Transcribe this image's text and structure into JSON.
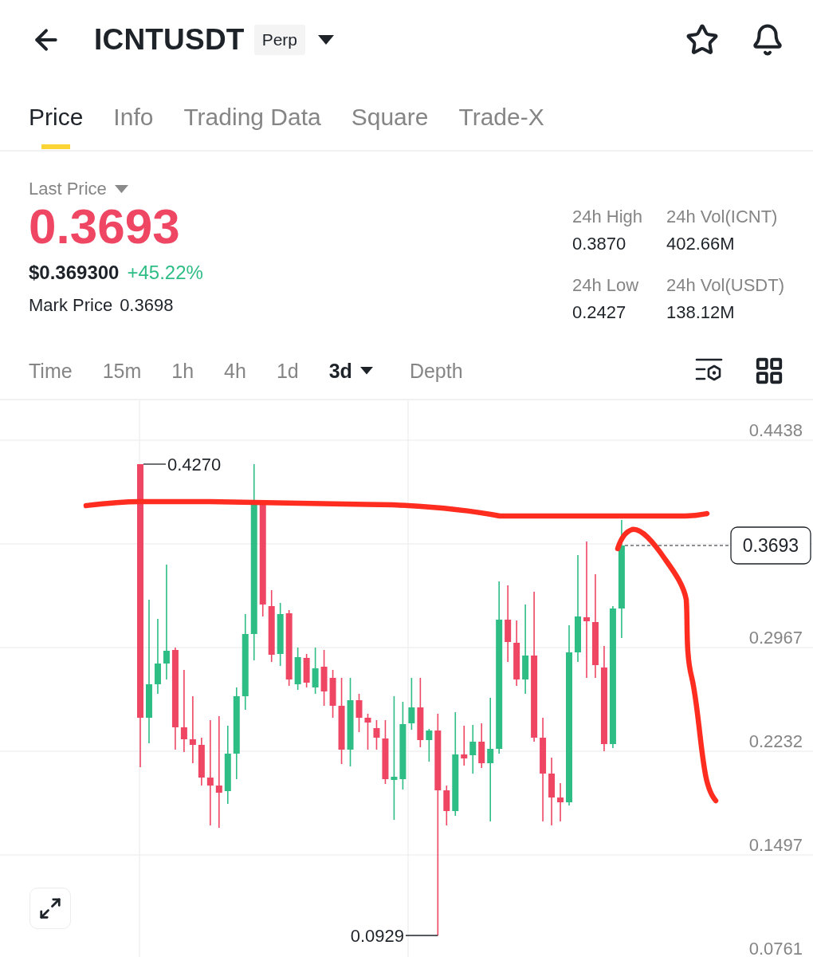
{
  "header": {
    "title": "ICNTUSDT",
    "badge": "Perp"
  },
  "tabs": [
    {
      "label": "Price",
      "selected": true
    },
    {
      "label": "Info",
      "selected": false
    },
    {
      "label": "Trading Data",
      "selected": false
    },
    {
      "label": "Square",
      "selected": false
    },
    {
      "label": "Trade-X",
      "selected": false
    }
  ],
  "price_panel": {
    "label": "Last Price",
    "last_price": "0.3693",
    "usd_price": "$0.369300",
    "change": "+45.22%",
    "mark_label": "Mark Price",
    "mark_price": "0.3698",
    "stats": [
      {
        "label": "24h High",
        "value": "0.3870"
      },
      {
        "label": "24h Vol(ICNT)",
        "value": "402.66M"
      },
      {
        "label": "24h Low",
        "value": "0.2427"
      },
      {
        "label": "24h Vol(USDT)",
        "value": "138.12M"
      }
    ]
  },
  "intervals": [
    {
      "label": "Time",
      "selected": false,
      "dropdown": false
    },
    {
      "label": "15m",
      "selected": false,
      "dropdown": false
    },
    {
      "label": "1h",
      "selected": false,
      "dropdown": false
    },
    {
      "label": "4h",
      "selected": false,
      "dropdown": false
    },
    {
      "label": "1d",
      "selected": false,
      "dropdown": false
    },
    {
      "label": "3d",
      "selected": true,
      "dropdown": true
    },
    {
      "label": "Depth",
      "selected": false,
      "dropdown": false
    }
  ],
  "chart": {
    "price_axis": [
      "0.4438",
      "0.2967",
      "0.2232",
      "0.1497",
      "0.0761"
    ],
    "high_label": "0.4270",
    "low_label": "0.0929",
    "current_price": "0.3693"
  }
}
